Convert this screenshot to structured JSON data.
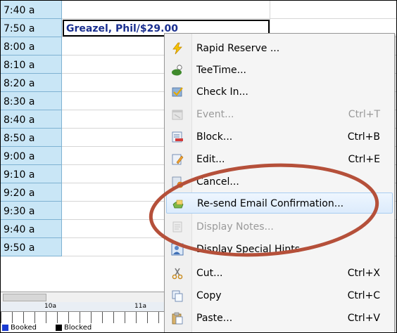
{
  "schedule": {
    "times": [
      "7:40 a",
      "7:50 a",
      "8:00 a",
      "8:10 a",
      "8:20 a",
      "8:30 a",
      "8:40 a",
      "8:50 a",
      "9:00 a",
      "9:10 a",
      "9:20 a",
      "9:30 a",
      "9:40 a",
      "9:50 a"
    ],
    "booking_text": "Greazel, Phil/$29.00"
  },
  "timeline": {
    "hours": [
      "10a",
      "11a"
    ],
    "legend": [
      {
        "label": "Booked",
        "color": "#1a3bd1"
      },
      {
        "label": "Blocked",
        "color": "#000000"
      }
    ]
  },
  "context_menu": {
    "items": [
      {
        "label": "Rapid Reserve ...",
        "shortcut": "",
        "icon": "lightning-icon",
        "enabled": true
      },
      {
        "label": "TeeTime...",
        "shortcut": "",
        "icon": "golf-ball-icon",
        "enabled": true
      },
      {
        "label": "Check In...",
        "shortcut": "",
        "icon": "check-in-icon",
        "enabled": true
      },
      {
        "label": "Event...",
        "shortcut": "Ctrl+T",
        "icon": "event-icon",
        "enabled": false
      },
      {
        "label": "Block...",
        "shortcut": "Ctrl+B",
        "icon": "block-icon",
        "enabled": true
      },
      {
        "label": "Edit...",
        "shortcut": "Ctrl+E",
        "icon": "edit-icon",
        "enabled": true
      },
      {
        "label": "Cancel...",
        "shortcut": "",
        "icon": "cancel-icon",
        "enabled": true
      },
      {
        "label": "Re-send Email Confirmation...",
        "shortcut": "",
        "icon": "email-icon",
        "enabled": true,
        "highlighted": true
      },
      {
        "label": "Display Notes...",
        "shortcut": "",
        "icon": "notes-icon",
        "enabled": false
      },
      {
        "label": "Display Special Hints",
        "shortcut": "",
        "icon": "special-hints-icon",
        "enabled": true
      },
      {
        "label": "Cut...",
        "shortcut": "Ctrl+X",
        "icon": "scissors-icon",
        "enabled": true
      },
      {
        "label": "Copy",
        "shortcut": "Ctrl+C",
        "icon": "copy-icon",
        "enabled": true
      },
      {
        "label": "Paste...",
        "shortcut": "Ctrl+V",
        "icon": "paste-icon",
        "enabled": true
      }
    ]
  },
  "colors": {
    "annotation": "#b5503a",
    "time_cell_bg": "#c9e6f6",
    "highlight_border": "#a8cdf1"
  }
}
